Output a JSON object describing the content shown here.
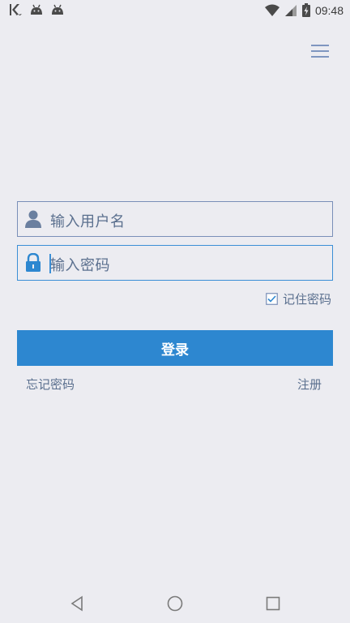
{
  "status_bar": {
    "time": "09:48",
    "left_icons": [
      "app-k-icon",
      "android-icon",
      "android-icon"
    ],
    "right_icons": [
      "wifi-icon",
      "signal-icon",
      "battery-charging-icon"
    ]
  },
  "header": {
    "menu_icon": "hamburger-menu-icon"
  },
  "form": {
    "username": {
      "placeholder": "输入用户名",
      "icon": "user-icon"
    },
    "password": {
      "placeholder": "输入密码",
      "icon": "lock-icon"
    },
    "remember": {
      "label": "记住密码",
      "checked": true
    },
    "login_label": "登录",
    "forgot_label": "忘记密码",
    "register_label": "注册"
  },
  "colors": {
    "background": "#ececf1",
    "primary": "#2d87d0",
    "text": "#5a6f8e"
  },
  "nav_bar": {
    "icons": [
      "back-icon",
      "home-icon",
      "recents-icon"
    ]
  }
}
